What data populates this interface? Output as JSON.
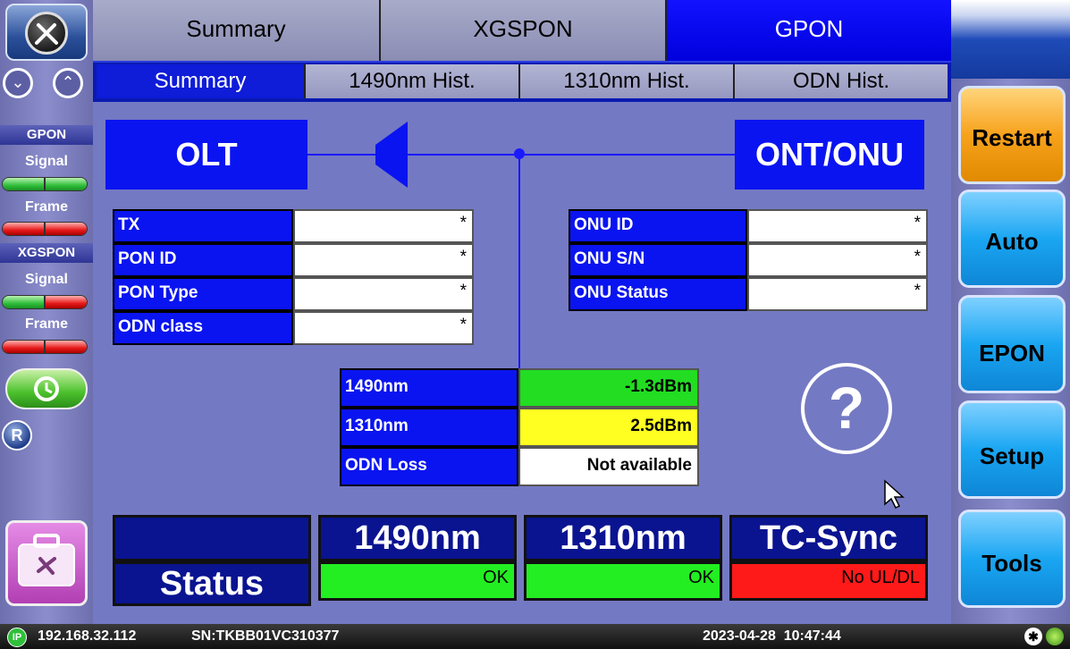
{
  "tabs": [
    "Summary",
    "XGSPON",
    "GPON"
  ],
  "active_tab": "GPON",
  "subtabs": [
    "Summary",
    "1490nm Hist.",
    "1310nm Hist.",
    "ODN Hist."
  ],
  "active_subtab": "Summary",
  "sidebar": {
    "gpon_label": "GPON",
    "gpon_signal": "Signal",
    "gpon_frame": "Frame",
    "xgspon_label": "XGSPON",
    "xgspon_signal": "Signal",
    "xgspon_frame": "Frame",
    "r_badge": "R"
  },
  "diagram": {
    "olt": "OLT",
    "ont": "ONT/ONU"
  },
  "olt_fields": [
    {
      "label": "TX",
      "value": "*"
    },
    {
      "label": "PON ID",
      "value": "*"
    },
    {
      "label": "PON Type",
      "value": "*"
    },
    {
      "label": "ODN class",
      "value": "*"
    }
  ],
  "onu_fields": [
    {
      "label": "ONU ID",
      "value": "*"
    },
    {
      "label": "ONU S/N",
      "value": "*"
    },
    {
      "label": "ONU Status",
      "value": "*"
    }
  ],
  "power": [
    {
      "label": "1490nm",
      "value": "-1.3dBm",
      "color": "#22dd22"
    },
    {
      "label": "1310nm",
      "value": "2.5dBm",
      "color": "#ffff22"
    },
    {
      "label": "ODN Loss",
      "value": "Not available",
      "color": "#ffffff"
    }
  ],
  "help_icon": "?",
  "status": {
    "row_label": "Status",
    "columns": [
      {
        "header": "1490nm",
        "value": "OK",
        "color": "#22ee22"
      },
      {
        "header": "1310nm",
        "value": "OK",
        "color": "#22ee22"
      },
      {
        "header": "TC-Sync",
        "value": "No UL/DL",
        "color": "#ff1a1a"
      }
    ]
  },
  "right_buttons": [
    {
      "label": "Restart",
      "style": "orange"
    },
    {
      "label": "Auto",
      "style": "blue"
    },
    {
      "label": "EPON",
      "style": "blue"
    },
    {
      "label": "Setup",
      "style": "blue"
    },
    {
      "label": "Tools",
      "style": "blue"
    }
  ],
  "statusbar": {
    "ip_badge": "IP",
    "ip": "192.168.32.112",
    "serial": "SN:TKBB01VC310377",
    "datetime": "2023-04-28  10:47:44"
  }
}
